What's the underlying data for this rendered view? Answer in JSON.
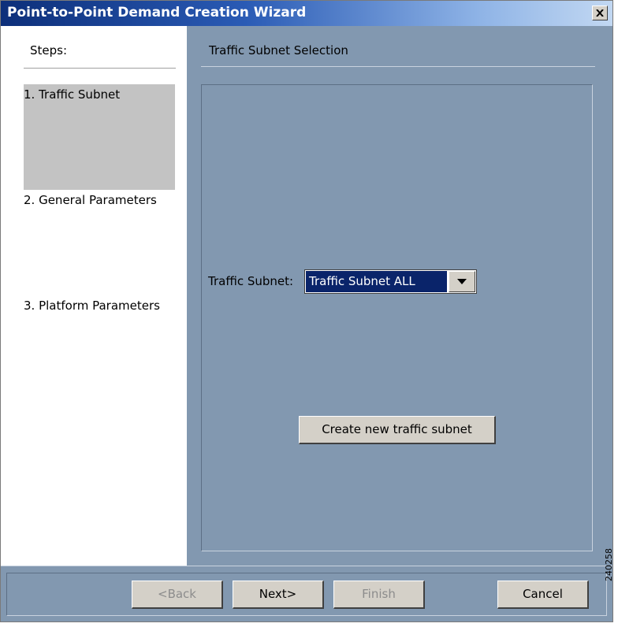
{
  "window": {
    "title": "Point-to-Point Demand Creation Wizard",
    "close_glyph": "✕"
  },
  "steps": {
    "header": "Steps:",
    "items": [
      {
        "label": "1. Traffic Subnet",
        "active": true
      },
      {
        "label": "2. General Parameters",
        "active": false
      },
      {
        "label": "3. Platform Parameters",
        "active": false
      }
    ]
  },
  "main": {
    "section_title": "Traffic Subnet Selection",
    "subnet_label": "Traffic Subnet:",
    "subnet_value": "Traffic Subnet ALL",
    "create_button": "Create new traffic subnet"
  },
  "buttons": {
    "back": "<Back",
    "next": "Next>",
    "finish": "Finish",
    "cancel": "Cancel"
  },
  "figure_id": "240258",
  "colors": {
    "title_bar_start": "#0d2f7a",
    "panel_bg": "#8298b0",
    "selection": "#0a246a",
    "active_step": "#c3c3c3"
  }
}
